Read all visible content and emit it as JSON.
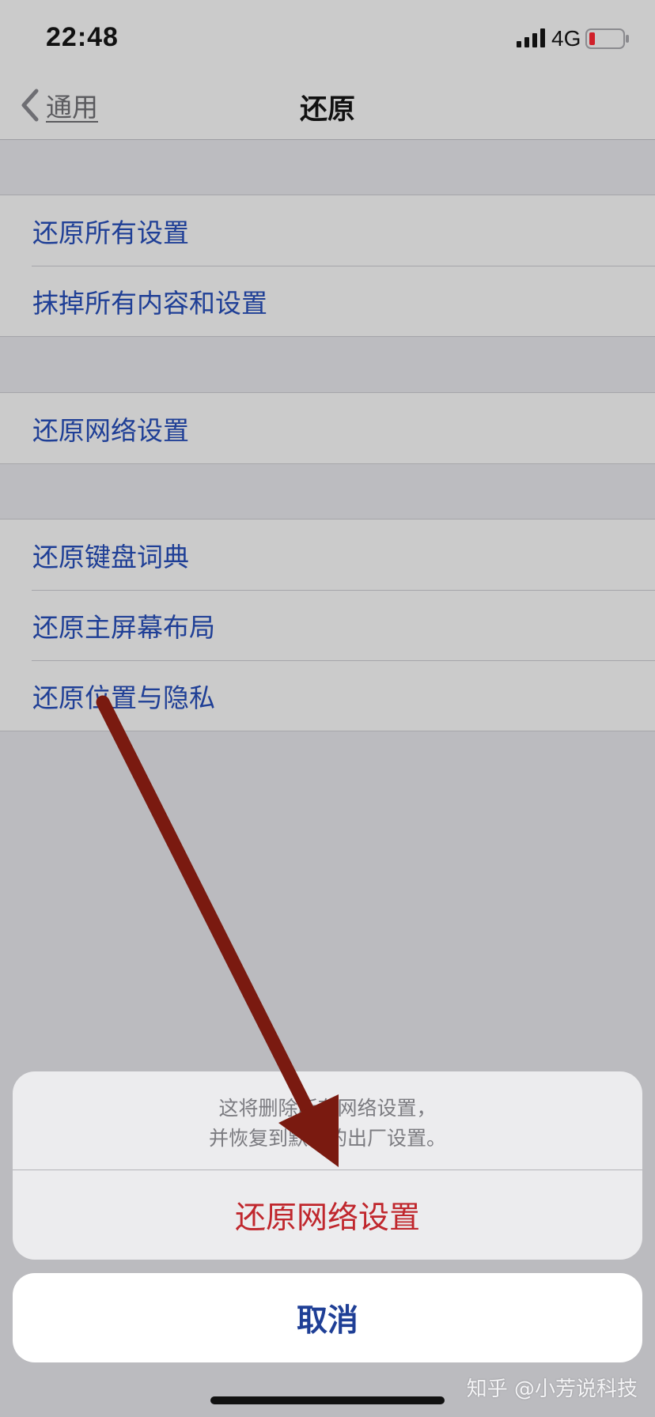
{
  "status_bar": {
    "time": "22:48",
    "network": "4G",
    "icons": [
      "signal-icon",
      "battery-low-icon"
    ]
  },
  "nav": {
    "back_label": "通用",
    "title": "还原",
    "back_icon": "chevron-left-icon"
  },
  "groups": [
    {
      "items": [
        {
          "label": "还原所有设置"
        },
        {
          "label": "抹掉所有内容和设置"
        }
      ]
    },
    {
      "items": [
        {
          "label": "还原网络设置"
        }
      ]
    },
    {
      "items": [
        {
          "label": "还原键盘词典"
        },
        {
          "label": "还原主屏幕布局"
        },
        {
          "label": "还原位置与隐私"
        }
      ]
    }
  ],
  "action_sheet": {
    "message_line1": "这将删除所有网络设置，",
    "message_line2": "并恢复到默认的出厂设置。",
    "destructive_label": "还原网络设置",
    "cancel_label": "取消"
  },
  "watermark": "知乎 @小芳说科技",
  "colors": {
    "link_blue": "#1f3f96",
    "destructive_red": "#c0272d",
    "annotation_arrow": "#7a1a10",
    "battery_low": "#d0202a"
  },
  "annotation": {
    "icon": "arrow-annotation-icon"
  }
}
